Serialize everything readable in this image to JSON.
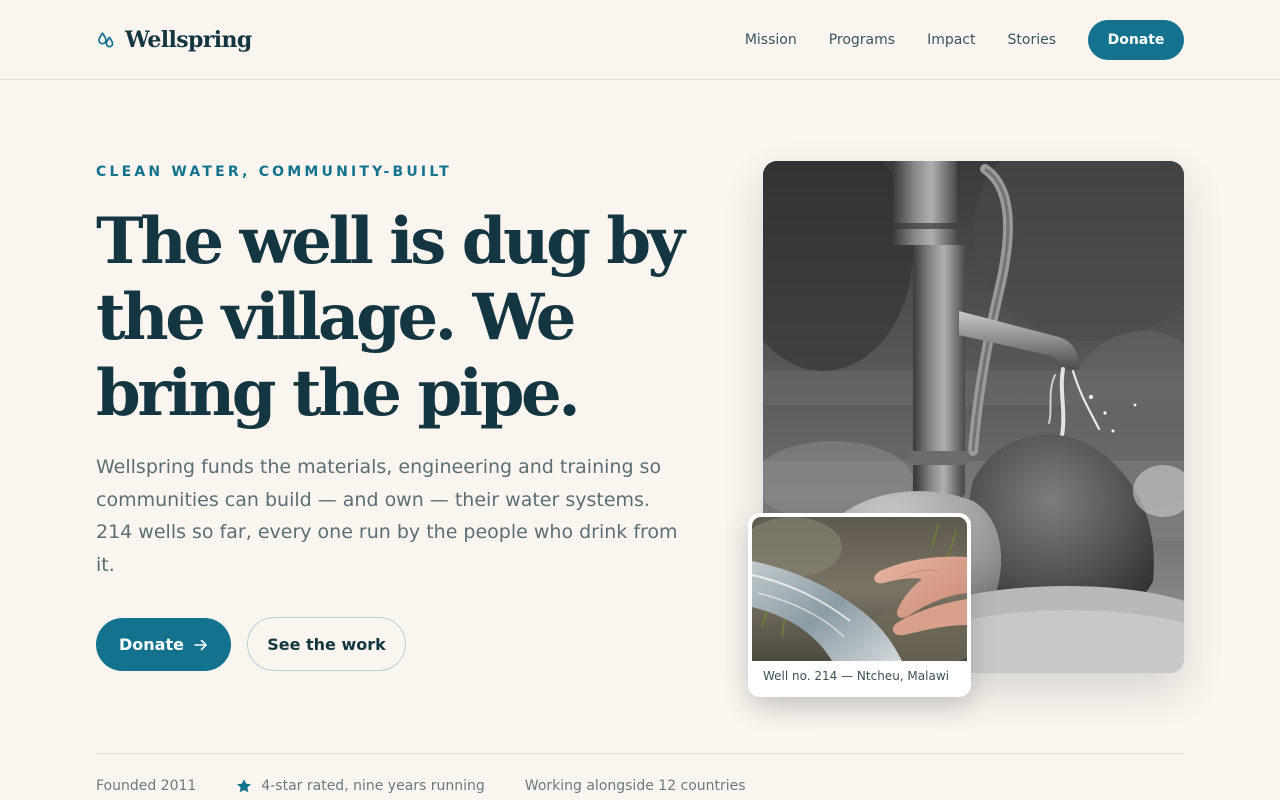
{
  "brand": {
    "name": "Wellspring",
    "icon": "water-drops-icon",
    "accent": "#13738f",
    "ink": "#143642",
    "background": "#faf5ef"
  },
  "nav": {
    "items": [
      {
        "label": "Mission"
      },
      {
        "label": "Programs"
      },
      {
        "label": "Impact"
      },
      {
        "label": "Stories"
      }
    ],
    "donate_label": "Donate"
  },
  "hero": {
    "eyebrow": "CLEAN WATER, COMMUNITY-BUILT",
    "headline": "The well is dug by the village. We bring the pipe.",
    "body": "Wellspring funds the materials, engineering and training so communities can build — and own — their water systems. 214 wells so far, every one run by the people who drink from it.",
    "primary_cta": {
      "label": "Donate",
      "icon": "arrow-right-icon"
    },
    "secondary_cta": {
      "label": "See the work"
    },
    "main_image": {
      "subject": "hand-pump-photo"
    },
    "inset_card": {
      "image": "hands-in-water-photo",
      "caption": "Well no. 214 — Ntcheu, Malawi"
    }
  },
  "trust": {
    "items": [
      {
        "text": "Founded 2011"
      },
      {
        "text": "4-star rated, nine years running",
        "icon": "star-icon"
      },
      {
        "text": "Working alongside 12 countries"
      }
    ]
  }
}
